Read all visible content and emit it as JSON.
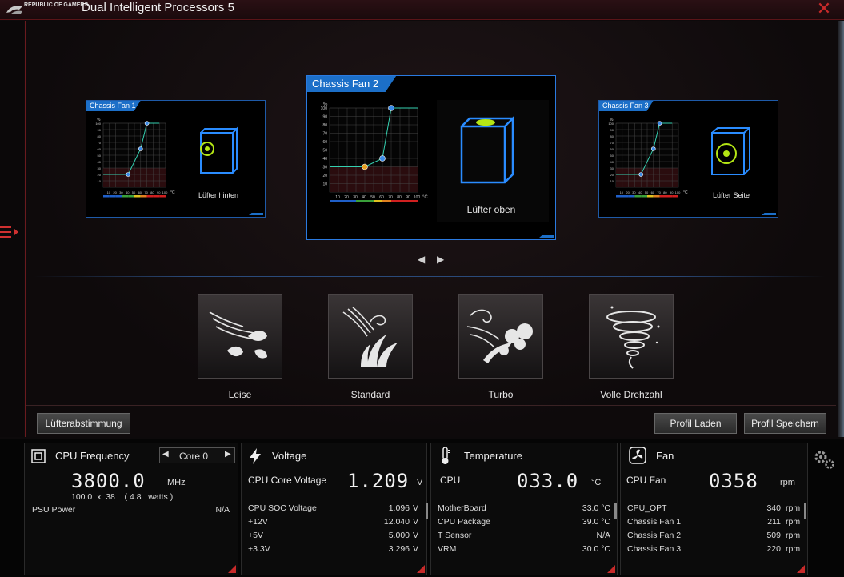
{
  "app": {
    "brand": "REPUBLIC OF GAMERS",
    "title": "Dual Intelligent Processors 5"
  },
  "fans": {
    "fan1": {
      "name": "Chassis Fan 1",
      "label": "Lüfter hinten"
    },
    "fan2": {
      "name": "Chassis Fan 2",
      "label": "Lüfter oben"
    },
    "fan3": {
      "name": "Chassis Fan 3",
      "label": "Lüfter Seite"
    },
    "y_unit": "%",
    "x_unit": "°C",
    "y_ticks": [
      "100",
      "90",
      "80",
      "70",
      "60",
      "50",
      "40",
      "30",
      "20",
      "10"
    ],
    "x_ticks": [
      "10",
      "20",
      "30",
      "40",
      "50",
      "60",
      "70",
      "80",
      "90",
      "100"
    ]
  },
  "profiles": [
    {
      "label": "Leise"
    },
    {
      "label": "Standard"
    },
    {
      "label": "Turbo"
    },
    {
      "label": "Volle Drehzahl"
    }
  ],
  "buttons": {
    "tune": "Lüfterabstimmung",
    "load": "Profil Laden",
    "save": "Profil Speichern"
  },
  "cpu_freq": {
    "title": "CPU Frequency",
    "core_select": "Core 0",
    "value": "3800.0",
    "unit": "MHz",
    "detail": "100.0  x  38    ( 4.8   watts )",
    "psu_label": "PSU Power",
    "psu_value": "N/A"
  },
  "voltage": {
    "title": "Voltage",
    "main_label": "CPU Core Voltage",
    "main_value": "1.209",
    "main_unit": "V",
    "rows": [
      {
        "label": "CPU SOC Voltage",
        "value": "1.096",
        "unit": "V"
      },
      {
        "label": "+12V",
        "value": "12.040",
        "unit": "V"
      },
      {
        "label": "+5V",
        "value": "5.000",
        "unit": "V"
      },
      {
        "label": "+3.3V",
        "value": "3.296",
        "unit": "V"
      }
    ]
  },
  "temperature": {
    "title": "Temperature",
    "main_label": "CPU",
    "main_value": "033.0",
    "main_unit": "°C",
    "rows": [
      {
        "label": "MotherBoard",
        "value": "33.0 °C"
      },
      {
        "label": "CPU Package",
        "value": "39.0 °C"
      },
      {
        "label": "T Sensor",
        "value": "N/A"
      },
      {
        "label": "VRM",
        "value": "30.0 °C"
      }
    ]
  },
  "fan": {
    "title": "Fan",
    "main_label": "CPU Fan",
    "main_value": "0358",
    "main_unit": "rpm",
    "rows": [
      {
        "label": "CPU_OPT",
        "value": "340",
        "unit": "rpm"
      },
      {
        "label": "Chassis Fan 1",
        "value": "211",
        "unit": "rpm"
      },
      {
        "label": "Chassis Fan 2",
        "value": "509",
        "unit": "rpm"
      },
      {
        "label": "Chassis Fan 3",
        "value": "220",
        "unit": "rpm"
      }
    ]
  }
}
